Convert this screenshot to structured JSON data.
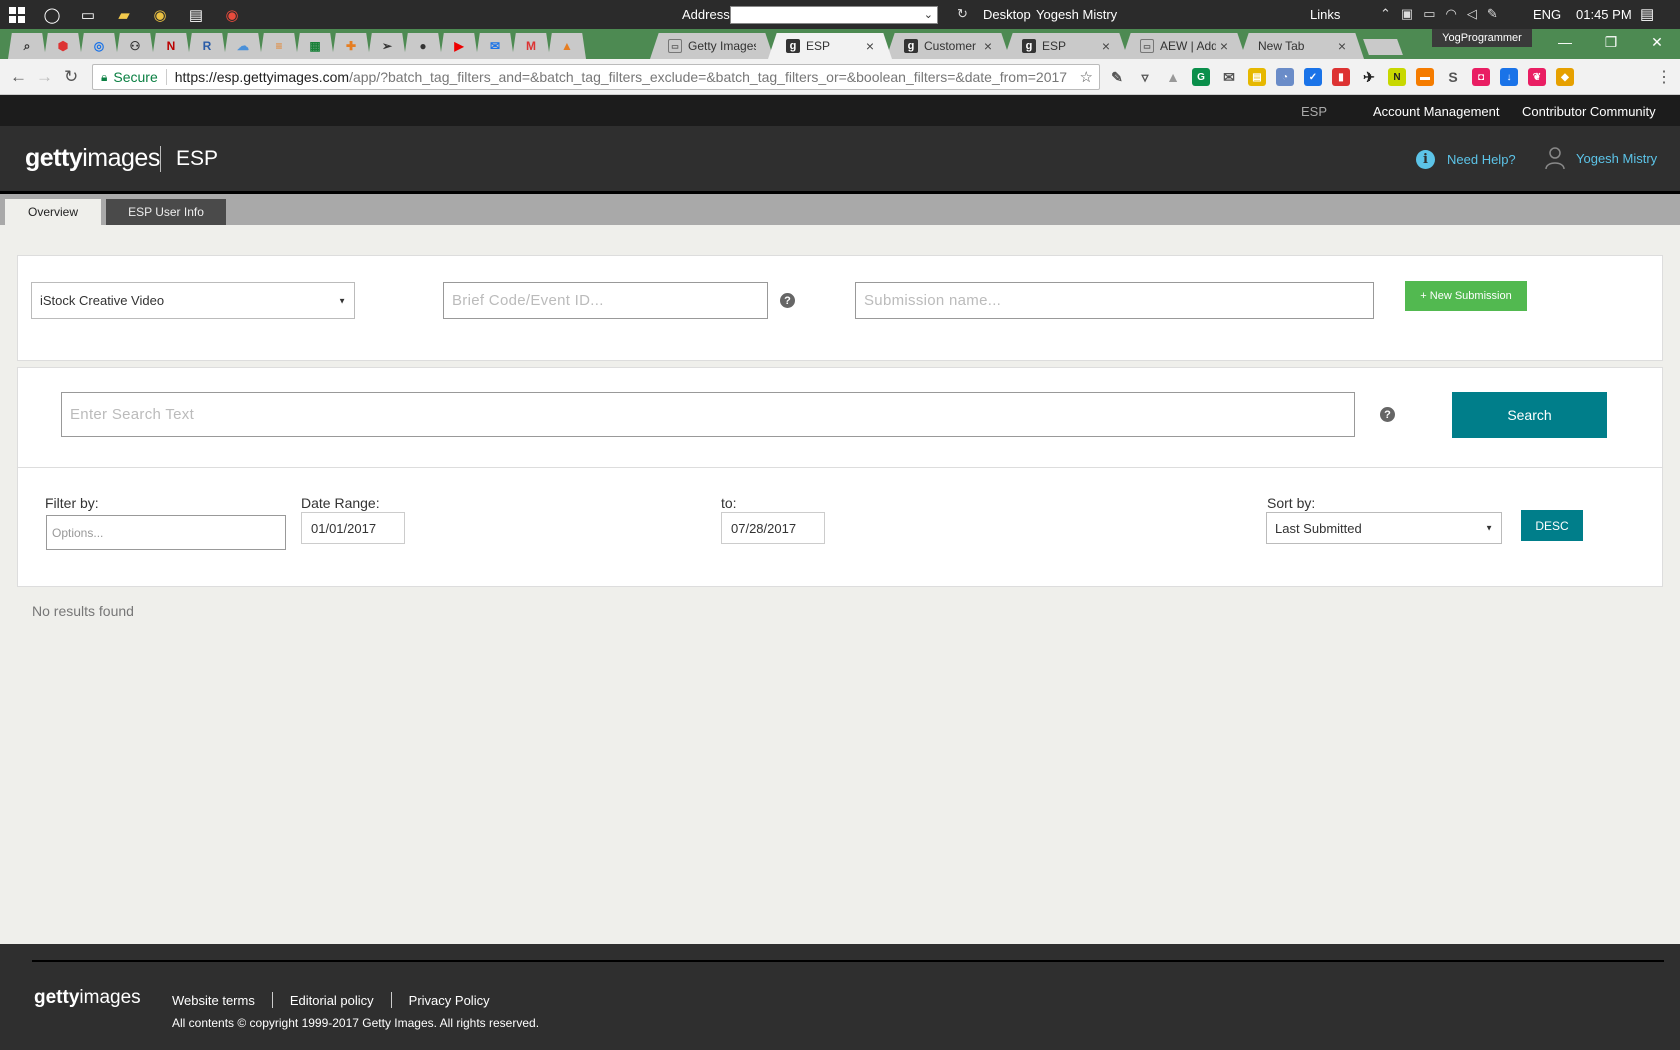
{
  "taskbar": {
    "address_label": "Address",
    "desktop_label": "Desktop",
    "user_name": "Yogesh Mistry",
    "links_label": "Links",
    "language": "ENG",
    "time": "01:45 PM"
  },
  "browser": {
    "tabs": [
      {
        "title": "Getty Images",
        "favicon": "doc-icon",
        "active": false
      },
      {
        "title": "ESP",
        "favicon": "getty-g-icon",
        "active": true
      },
      {
        "title": "Customer Se",
        "favicon": "getty-g-icon",
        "active": false
      },
      {
        "title": "ESP",
        "favicon": "getty-g-icon",
        "active": false
      },
      {
        "title": "AEW | Add E",
        "favicon": "doc-icon",
        "active": false
      },
      {
        "title": "New Tab",
        "favicon": "",
        "active": false
      }
    ],
    "profile_badge": "YogProgrammer",
    "secure_label": "Secure",
    "url_host": "https://esp.gettyimages.com",
    "url_rest": "/app/?batch_tag_filters_and=&batch_tag_filters_exclude=&batch_tag_filters_or=&boolean_filters=&date_from=2017"
  },
  "topnav": {
    "esp": "ESP",
    "account_management": "Account Management",
    "contributor_community": "Contributor Community"
  },
  "header": {
    "logo_bold": "getty",
    "logo_light": "images",
    "app_title": "ESP",
    "help_label": "Need Help?",
    "user_label": "Yogesh Mistry"
  },
  "subnav": {
    "overview": "Overview",
    "user_info": "ESP User Info"
  },
  "submission": {
    "collection_selected": "iStock Creative Video",
    "brief_placeholder": "Brief Code/Event ID...",
    "name_placeholder": "Submission name...",
    "new_button": "+ New Submission"
  },
  "search": {
    "placeholder": "Enter Search Text",
    "button": "Search"
  },
  "filters": {
    "filter_label": "Filter by:",
    "filter_placeholder": "Options...",
    "date_label": "Date Range:",
    "date_from": "01/01/2017",
    "to_label": "to:",
    "date_to": "07/28/2017",
    "sort_label": "Sort by:",
    "sort_selected": "Last Submitted",
    "order_button": "DESC"
  },
  "results": {
    "message": "No results found"
  },
  "footer": {
    "logo_bold": "getty",
    "logo_light": "images",
    "links": [
      "Website terms",
      "Editorial policy",
      "Privacy Policy"
    ],
    "copyright": "All contents © copyright 1999-2017 Getty Images. All rights reserved."
  },
  "colors": {
    "teal": "#007e8a",
    "green": "#52b950",
    "link_blue": "#5cc4e8",
    "header_bg": "#2f2f2f"
  }
}
